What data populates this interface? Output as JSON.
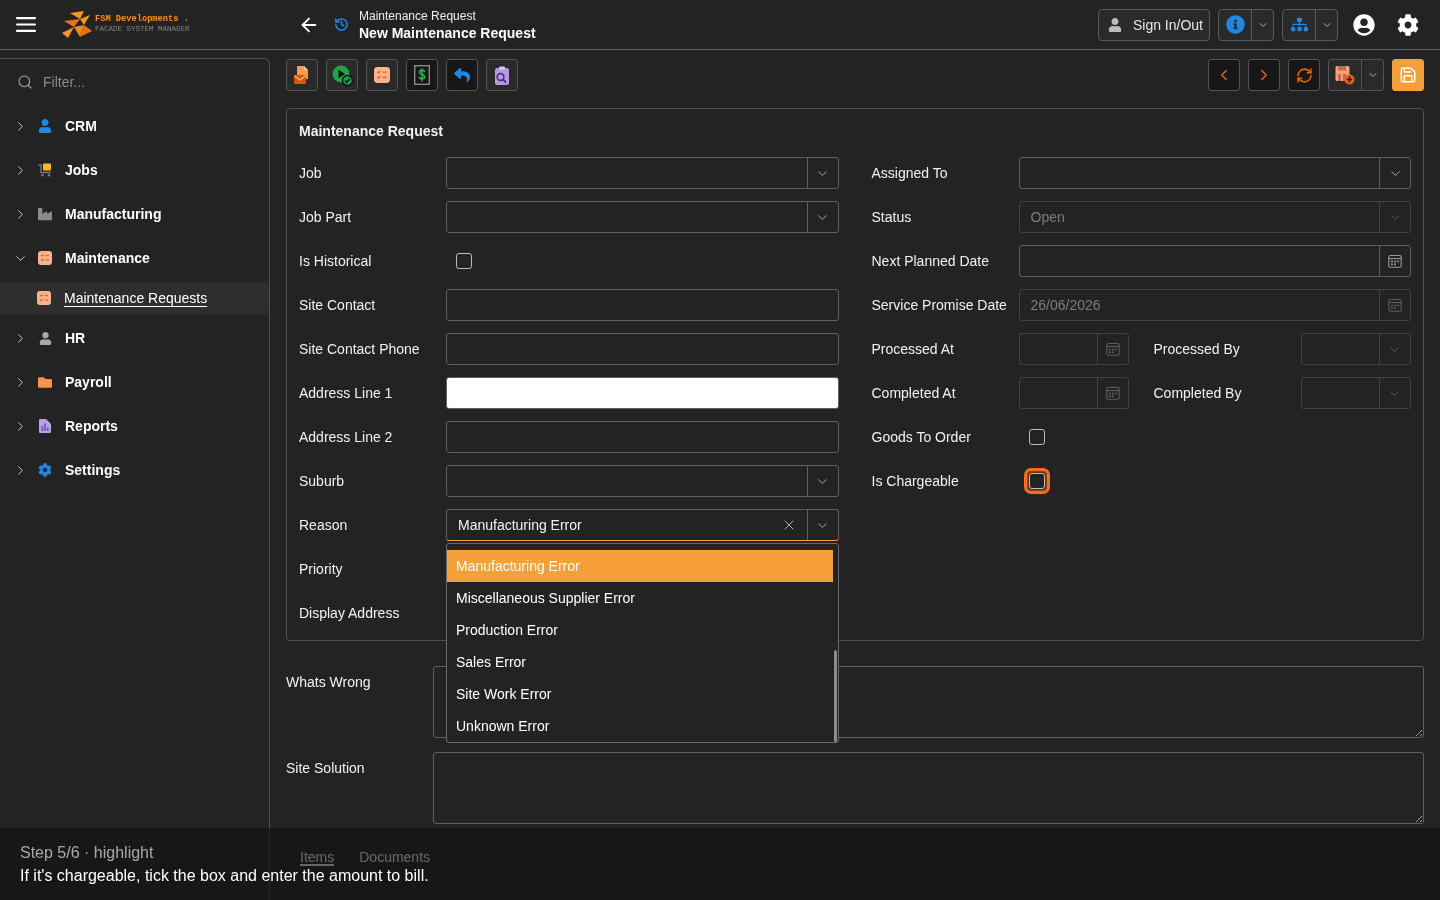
{
  "topbar": {
    "logo_name": "FSM Developments .",
    "logo_tagline": "FACADE SYSTEM MANAGER",
    "breadcrumb": "Maintenance Request",
    "title": "New Maintenance Request",
    "sign_in": "Sign In/Out"
  },
  "sidebar": {
    "filter_placeholder": "Filter...",
    "items": [
      {
        "label": "CRM",
        "expanded": false,
        "selected": false
      },
      {
        "label": "Jobs",
        "expanded": false,
        "selected": false
      },
      {
        "label": "Manufacturing",
        "expanded": false,
        "selected": false
      },
      {
        "label": "Maintenance",
        "expanded": true,
        "selected": false,
        "children": [
          {
            "label": "Maintenance Requests",
            "selected": true
          }
        ]
      },
      {
        "label": "HR",
        "expanded": false,
        "selected": false
      },
      {
        "label": "Payroll",
        "expanded": false,
        "selected": false
      },
      {
        "label": "Reports",
        "expanded": false,
        "selected": false
      },
      {
        "label": "Settings",
        "expanded": false,
        "selected": false
      }
    ]
  },
  "form": {
    "title": "Maintenance Request",
    "left": [
      {
        "label": "Job",
        "kind": "select"
      },
      {
        "label": "Job Part",
        "kind": "select"
      },
      {
        "label": "Is Historical",
        "kind": "checkbox",
        "checked": false
      },
      {
        "label": "Site Contact",
        "kind": "text"
      },
      {
        "label": "Site Contact Phone",
        "kind": "text"
      },
      {
        "label": "Address Line 1",
        "kind": "text",
        "autofill": true
      },
      {
        "label": "Address Line 2",
        "kind": "text"
      },
      {
        "label": "Suburb",
        "kind": "select"
      },
      {
        "label": "Reason",
        "kind": "select",
        "value": "Manufacturing Error",
        "focused": true,
        "open": true,
        "options": [
          {
            "label": "Manufacturing Error",
            "selected": true
          },
          {
            "label": "Miscellaneous Supplier Error",
            "selected": false
          },
          {
            "label": "Production Error",
            "selected": false
          },
          {
            "label": "Sales Error",
            "selected": false
          },
          {
            "label": "Site Work Error",
            "selected": false
          },
          {
            "label": "Unknown Error",
            "selected": false
          }
        ]
      },
      {
        "label": "Priority"
      },
      {
        "label": "Display Address"
      }
    ],
    "right": [
      {
        "fields": [
          {
            "label": "Assigned To",
            "kind": "select",
            "disabled": false
          }
        ]
      },
      {
        "fields": [
          {
            "label": "Status",
            "kind": "select",
            "value": "Open",
            "disabled": true
          }
        ]
      },
      {
        "fields": [
          {
            "label": "Next Planned Date",
            "kind": "date",
            "disabled": false
          }
        ]
      },
      {
        "fields": [
          {
            "label": "Service Promise Date",
            "kind": "date",
            "value": "26/06/2026",
            "disabled": true
          }
        ]
      },
      {
        "fields": [
          {
            "label": "Processed At",
            "kind": "date",
            "disabled": true
          },
          {
            "label": "Processed By",
            "kind": "select",
            "disabled": true
          }
        ]
      },
      {
        "fields": [
          {
            "label": "Completed At",
            "kind": "date",
            "disabled": true
          },
          {
            "label": "Completed By",
            "kind": "select",
            "disabled": true
          }
        ]
      },
      {
        "fields": [
          {
            "label": "Goods To Order",
            "kind": "checkbox",
            "checked": false
          }
        ]
      },
      {
        "fields": [
          {
            "label": "Is Chargeable",
            "kind": "checkbox",
            "checked": false,
            "highlighted": true
          }
        ]
      }
    ]
  },
  "notes": [
    {
      "label": "Whats Wrong"
    },
    {
      "label": "Site Solution"
    }
  ],
  "tabs": [
    {
      "label": "Items",
      "selected": true
    },
    {
      "label": "Documents",
      "selected": false
    }
  ],
  "tour": {
    "step": "Step 5/6 · highlight",
    "message": "If it's chargeable, tick the box and enter the amount to bill."
  }
}
